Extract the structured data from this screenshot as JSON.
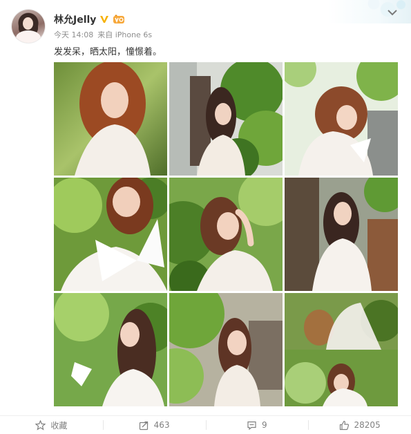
{
  "post": {
    "username": "林允Jelly",
    "time": "今天 14:08",
    "source": "来自 iPhone 6s",
    "text": "发发呆，晒太阳，憧憬着。",
    "photo_count": 9
  },
  "actions": {
    "favorite_label": "收藏",
    "repost_count": "463",
    "comment_count": "9",
    "like_count": "28205"
  },
  "icons": {
    "verified": "vip-v-icon",
    "member": "member-badge-icon",
    "menu": "chevron-down-icon",
    "favorite": "star-icon",
    "repost": "share-arrow-icon",
    "comment": "comment-bubble-icon",
    "like": "thumbs-up-icon"
  },
  "colors": {
    "username": "#333333",
    "meta": "#8e8e8e",
    "verified": "#f6b000",
    "action_text": "#808080"
  }
}
